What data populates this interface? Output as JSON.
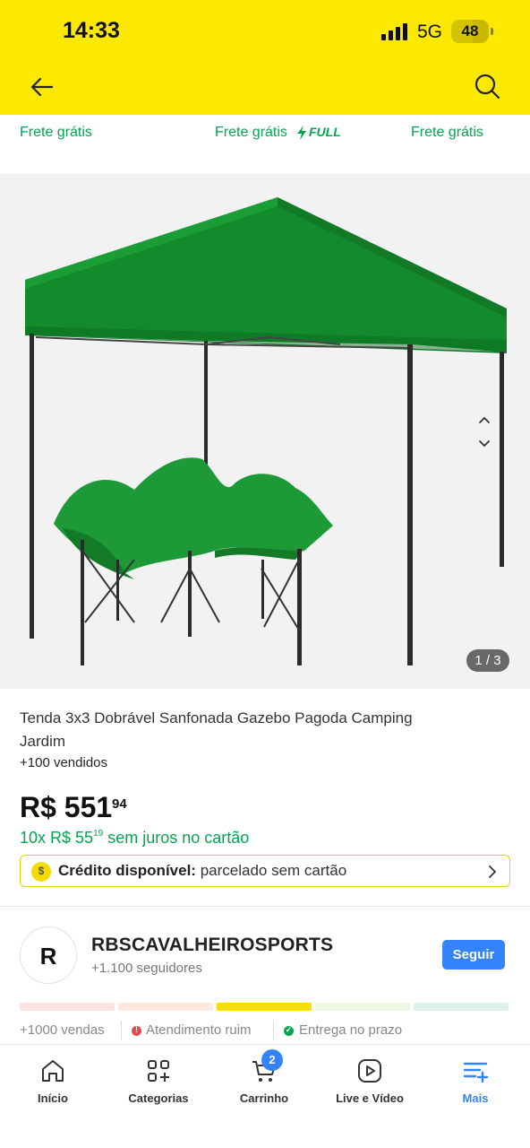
{
  "status_bar": {
    "time": "14:33",
    "network": "5G",
    "battery": "48"
  },
  "header": {
    "back_icon": "arrow-left-icon",
    "search_icon": "search-icon",
    "background": "#fde900"
  },
  "shipping_row": {
    "items": [
      {
        "label": "Frete grátis"
      },
      {
        "label": "Frete grátis",
        "badge": "FULL"
      },
      {
        "label": "Frete grátis"
      }
    ]
  },
  "gallery": {
    "counter": "1 / 3"
  },
  "product": {
    "title": "Tenda 3x3 Dobrável Sanfonada Gazebo Pagoda Camping Jardim",
    "sold": "+100 vendidos",
    "price_main": "R$ 551",
    "price_cents": "94",
    "installments_prefix": "10x R$ 55",
    "installments_cents": "19",
    "installments_suffix": " sem juros no cartão",
    "credit_label": "Crédito disponível:",
    "credit_text": " parcelado sem cartão"
  },
  "seller": {
    "initial": "R",
    "name": "RBSCAVALHEIROSPORTS",
    "followers": "+1.100 seguidores",
    "follow_label": "Seguir",
    "sales": "+1000 vendas",
    "service": "Atendimento ruim",
    "delivery": "Entrega no prazo",
    "thermometer_colors": [
      "#fde2e2",
      "#fee9df",
      "#f7de00",
      "#edf7e4",
      "#dcf2e6"
    ]
  },
  "nav": {
    "tabs": [
      {
        "label": "Início",
        "icon": "home-icon"
      },
      {
        "label": "Categorias",
        "icon": "categories-icon"
      },
      {
        "label": "Carrinho",
        "icon": "cart-icon"
      },
      {
        "label": "Live e Vídeo",
        "icon": "play-icon"
      },
      {
        "label": "Mais",
        "icon": "menu-plus-icon"
      }
    ],
    "cart_badge": "2",
    "accent": "#3483fa"
  },
  "colors": {
    "green": "#00a650",
    "blue": "#3483fa",
    "yellow": "#fde900"
  }
}
